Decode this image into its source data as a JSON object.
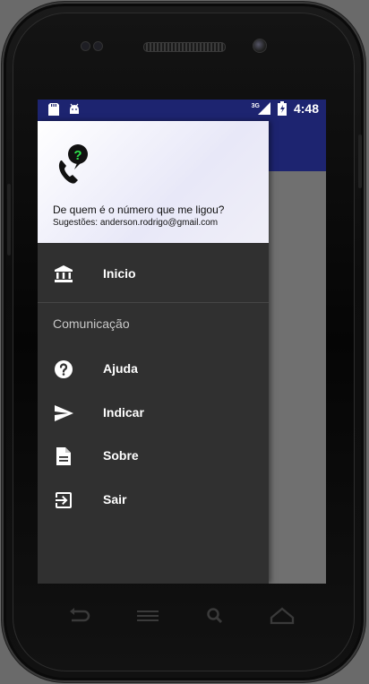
{
  "status_bar": {
    "network": "3G",
    "time": "4:48"
  },
  "drawer": {
    "header": {
      "title": "De quem é o número que me ligou?",
      "subtitle": "Sugestões: anderson.rodrigo@gmail.com"
    },
    "items": [
      {
        "label": "Inicio",
        "icon": "bank-icon"
      }
    ],
    "section": {
      "label": "Comunicação",
      "items": [
        {
          "label": "Ajuda",
          "icon": "help-icon"
        },
        {
          "label": "Indicar",
          "icon": "send-icon"
        },
        {
          "label": "Sobre",
          "icon": "document-icon"
        },
        {
          "label": "Sair",
          "icon": "exit-icon"
        }
      ]
    }
  },
  "nav_bar": {
    "buttons": [
      "back-icon",
      "menu-icon",
      "search-icon",
      "home-icon"
    ]
  },
  "colors": {
    "primary": "#1d2470",
    "drawer_bg": "#303030",
    "icon_accent": "#2ee24a"
  }
}
